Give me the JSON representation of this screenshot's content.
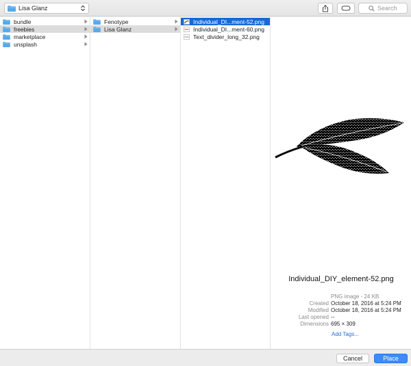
{
  "toolbar": {
    "location_label": "Lisa Glanz",
    "search_placeholder": "Search"
  },
  "columns": {
    "col1": [
      {
        "label": "bundle"
      },
      {
        "label": "freebies"
      },
      {
        "label": "marketplace"
      },
      {
        "label": "unsplash"
      }
    ],
    "col2": [
      {
        "label": "Fenotype"
      },
      {
        "label": "Lisa Glanz"
      }
    ],
    "col3": [
      {
        "label": "Individual_DI...ment-52.png"
      },
      {
        "label": "Individual_DI...ment-60.png"
      },
      {
        "label": "Text_divider_long_32.png"
      }
    ]
  },
  "preview": {
    "filename": "Individual_DIY_element-52.png",
    "kind": "PNG image - 24 KB",
    "created_label": "Created",
    "created_value": "October 18, 2016 at 5:24 PM",
    "modified_label": "Modified",
    "modified_value": "October 18, 2016 at 5:24 PM",
    "last_opened_label": "Last opened",
    "last_opened_value": "--",
    "dimensions_label": "Dimensions",
    "dimensions_value": "695 × 309",
    "add_tags": "Add Tags..."
  },
  "footer": {
    "cancel_label": "Cancel",
    "place_label": "Place"
  },
  "colors": {
    "selection_blue": "#1769d6",
    "folder_blue": "#5aa9e6",
    "place_button": "#3b8cf4",
    "link_blue": "#1e6fd9"
  },
  "icons": {
    "toolbar": [
      "folder-icon",
      "updown-arrows-icon",
      "share-icon",
      "tag-icon",
      "search-icon"
    ],
    "rows": [
      "folder-icon",
      "chevron-right-icon",
      "image-file-icon"
    ]
  }
}
